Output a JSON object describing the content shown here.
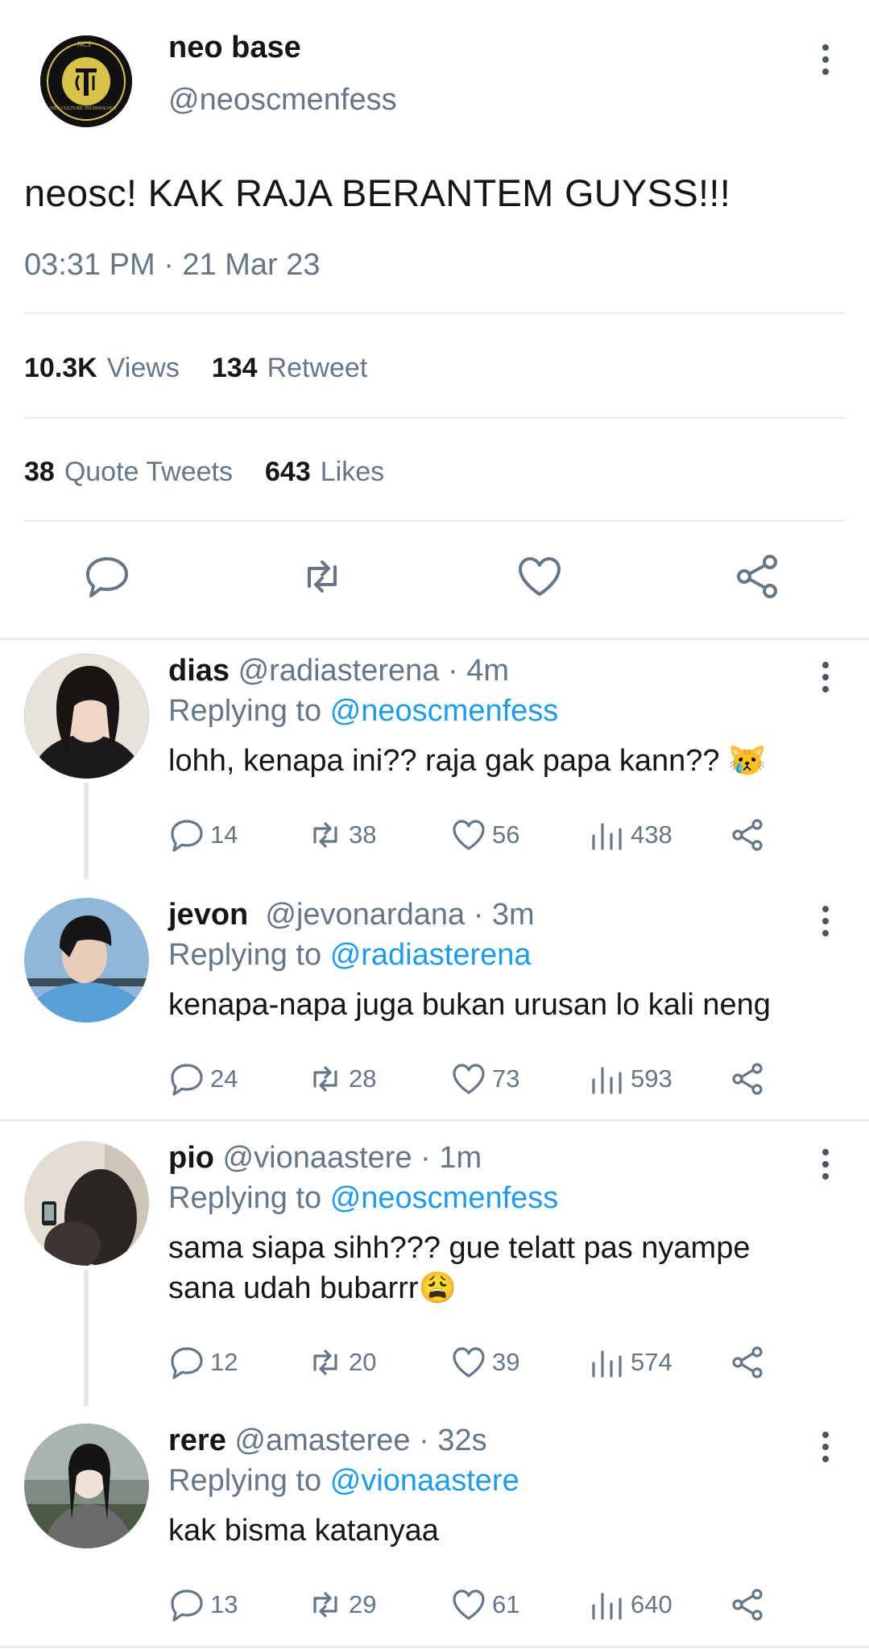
{
  "main_tweet": {
    "display_name": "neo base",
    "handle": "@neoscmenfess",
    "logo_text_top": "NCT",
    "logo_text_bottom": "NEO CULTURE TECHNOLOGY",
    "text": "neosc! KAK RAJA BERANTEM GUYSS!!!",
    "timestamp": "03:31 PM · 21 Mar 23",
    "stats": {
      "views_count": "10.3K",
      "views_label": "Views",
      "retweets_count": "134",
      "retweets_label": "Retweet",
      "quotes_count": "38",
      "quotes_label": "Quote Tweets",
      "likes_count": "643",
      "likes_label": "Likes"
    },
    "icons": [
      "reply-icon",
      "retweet-icon",
      "like-icon",
      "share-icon"
    ]
  },
  "replies": [
    {
      "name": "dias",
      "handle": "@radiasterena",
      "time": "· 4m",
      "replying_label": "Replying to",
      "replying_to": "@neoscmenfess",
      "text": "lohh, kenapa ini?? raja gak papa kann?? 😿",
      "replies": "14",
      "retweets": "38",
      "likes": "56",
      "views": "438",
      "avatar_color": "#2a2522"
    },
    {
      "name": "jevon",
      "handle": "@jevonardana",
      "time": "· 3m",
      "replying_label": "Replying to",
      "replying_to": "@radiasterena",
      "text": "kenapa-napa juga bukan urusan lo kali neng",
      "replies": "24",
      "retweets": "28",
      "likes": "73",
      "views": "593",
      "avatar_color": "#6fa3cf"
    },
    {
      "name": "pio",
      "handle": "@vionaastere",
      "time": "· 1m",
      "replying_label": "Replying to",
      "replying_to": "@neoscmenfess",
      "text": "sama siapa sihh??? gue telatt pas nyampe sana udah bubarrr😩",
      "replies": "12",
      "retweets": "20",
      "likes": "39",
      "views": "574",
      "avatar_color": "#c9bfb5"
    },
    {
      "name": "rere",
      "handle": "@amasteree",
      "time": "· 32s",
      "replying_label": "Replying to",
      "replying_to": "@vionaastere",
      "text": "kak bisma katanyaa",
      "replies": "13",
      "retweets": "29",
      "likes": "61",
      "views": "640",
      "avatar_color": "#4b5a47"
    }
  ],
  "colors": {
    "link": "#1d9bf0",
    "muted": "#657786",
    "divider": "#e6ecf0"
  }
}
